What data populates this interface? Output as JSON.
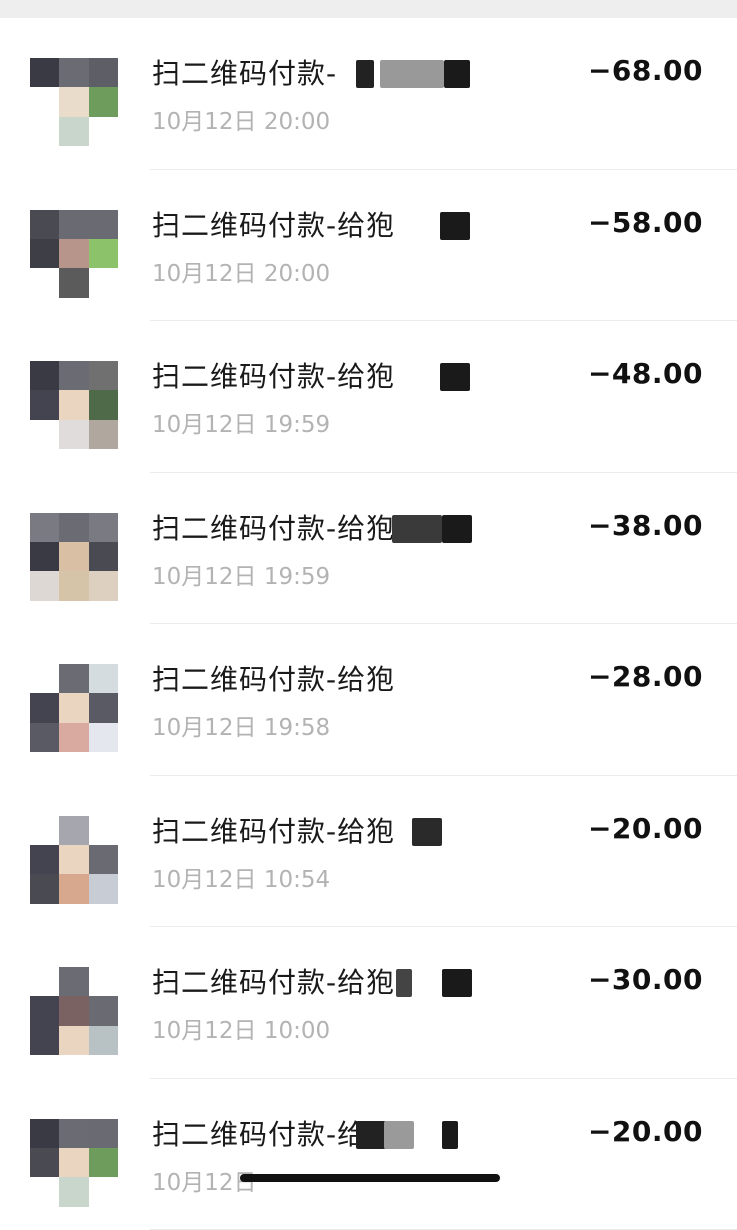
{
  "transactions": [
    {
      "title": "扫二维码付款-",
      "time": "10月12日 20:00",
      "amount": "−68.00",
      "avatar": [
        "#3a3a44",
        "#6b6b73",
        "#5e5e66",
        "#ffffff",
        "#e9dccb",
        "#6e9c5c",
        "#ffffff",
        "#c8d6cc",
        "#ffffff"
      ]
    },
    {
      "title": "扫二维码付款-给狍",
      "time": "10月12日 20:00",
      "amount": "−58.00",
      "avatar": [
        "#4a4a52",
        "#6a6a72",
        "#6a6a72",
        "#3e3e46",
        "#b8958a",
        "#8bc26a",
        "#ffffff",
        "#5b5b5b",
        "#ffffff"
      ]
    },
    {
      "title": "扫二维码付款-给狍",
      "time": "10月12日 19:59",
      "amount": "−48.00",
      "avatar": [
        "#3a3a44",
        "#6b6b73",
        "#707070",
        "#444450",
        "#ead5c0",
        "#4f6a48",
        "#ffffff",
        "#e0dcdc",
        "#b0a89e"
      ]
    },
    {
      "title": "扫二维码付款-给狍",
      "time": "10月12日 19:59",
      "amount": "−38.00",
      "avatar": [
        "#7a7a82",
        "#6b6b73",
        "#7a7a82",
        "#3a3a44",
        "#d9c0a4",
        "#4a4a52",
        "#ded8d4",
        "#d6c4a8",
        "#ddd0c0"
      ]
    },
    {
      "title": "扫二维码付款-给狍",
      "time": "10月12日 19:58",
      "amount": "−28.00",
      "avatar": [
        "#ffffff",
        "#6b6b73",
        "#d4dce0",
        "#444450",
        "#ead5c0",
        "#5a5a64",
        "#5a5a64",
        "#d9aaa0",
        "#e4e8ee"
      ]
    },
    {
      "title": "扫二维码付款-给狍",
      "time": "10月12日 10:54",
      "amount": "−20.00",
      "avatar": [
        "#ffffff",
        "#a6a6ae",
        "#ffffff",
        "#444450",
        "#ead5c0",
        "#6a6a72",
        "#4a4a52",
        "#d7a88e",
        "#c8ccd4"
      ]
    },
    {
      "title": "扫二维码付款-给狍",
      "time": "10月12日 10:00",
      "amount": "−30.00",
      "avatar": [
        "#ffffff",
        "#6b6b73",
        "#ffffff",
        "#444450",
        "#7a6262",
        "#6a6a72",
        "#444450",
        "#ead5c0",
        "#b8c2c4"
      ]
    },
    {
      "title": "扫二维码付款-给",
      "time": "10月12日",
      "amount": "−20.00",
      "avatar": [
        "#3a3a44",
        "#6b6b73",
        "#6a6a72",
        "#4a4a52",
        "#ead5c0",
        "#6e9c5c",
        "#ffffff",
        "#c8d6cc",
        "#ffffff"
      ]
    }
  ]
}
